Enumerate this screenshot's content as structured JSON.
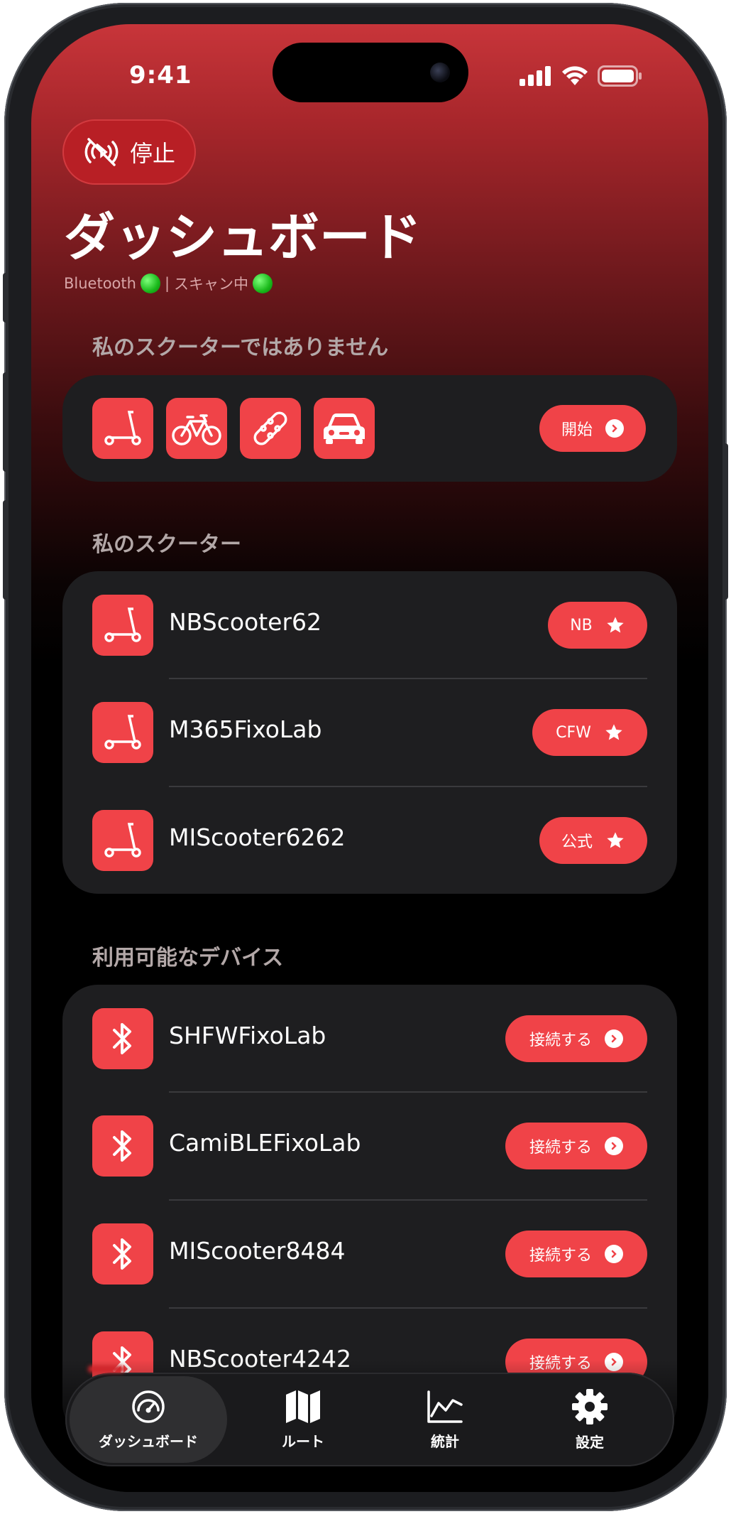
{
  "status": {
    "time": "9:41"
  },
  "stop_button": {
    "label": "停止",
    "icon": "bluetooth-off-icon"
  },
  "header": {
    "title": "ダッシュボード",
    "bluetooth_label": "Bluetooth",
    "separator": "|",
    "scan_label": "スキャン中",
    "status_color": "#1fbf1f"
  },
  "not_my_scooter": {
    "section_title": "私のスクーターではありません",
    "types": [
      "scooter-icon",
      "bicycle-icon",
      "skateboard-icon",
      "car-icon"
    ],
    "start_label": "開始"
  },
  "my_scooters": {
    "section_title": "私のスクーター",
    "items": [
      {
        "name": "NBScooter62",
        "badge": "NB"
      },
      {
        "name": "M365FixoLab",
        "badge": "CFW"
      },
      {
        "name": "MIScooter6262",
        "badge": "公式"
      }
    ]
  },
  "available_devices": {
    "section_title": "利用可能なデバイス",
    "connect_label": "接続する",
    "items": [
      {
        "name": "SHFWFixoLab"
      },
      {
        "name": "CamiBLEFixoLab"
      },
      {
        "name": "MIScooter8484"
      },
      {
        "name": "NBScooter4242"
      }
    ]
  },
  "tabbar": {
    "tabs": [
      {
        "label": "ダッシュボード",
        "icon": "speedometer-icon",
        "active": true
      },
      {
        "label": "ルート",
        "icon": "map-icon",
        "active": false
      },
      {
        "label": "統計",
        "icon": "chart-icon",
        "active": false
      },
      {
        "label": "設定",
        "icon": "gear-icon",
        "active": false
      }
    ]
  },
  "colors": {
    "accent": "#f04348",
    "card": "#1e1e20",
    "stop_button": "#b81f25"
  }
}
